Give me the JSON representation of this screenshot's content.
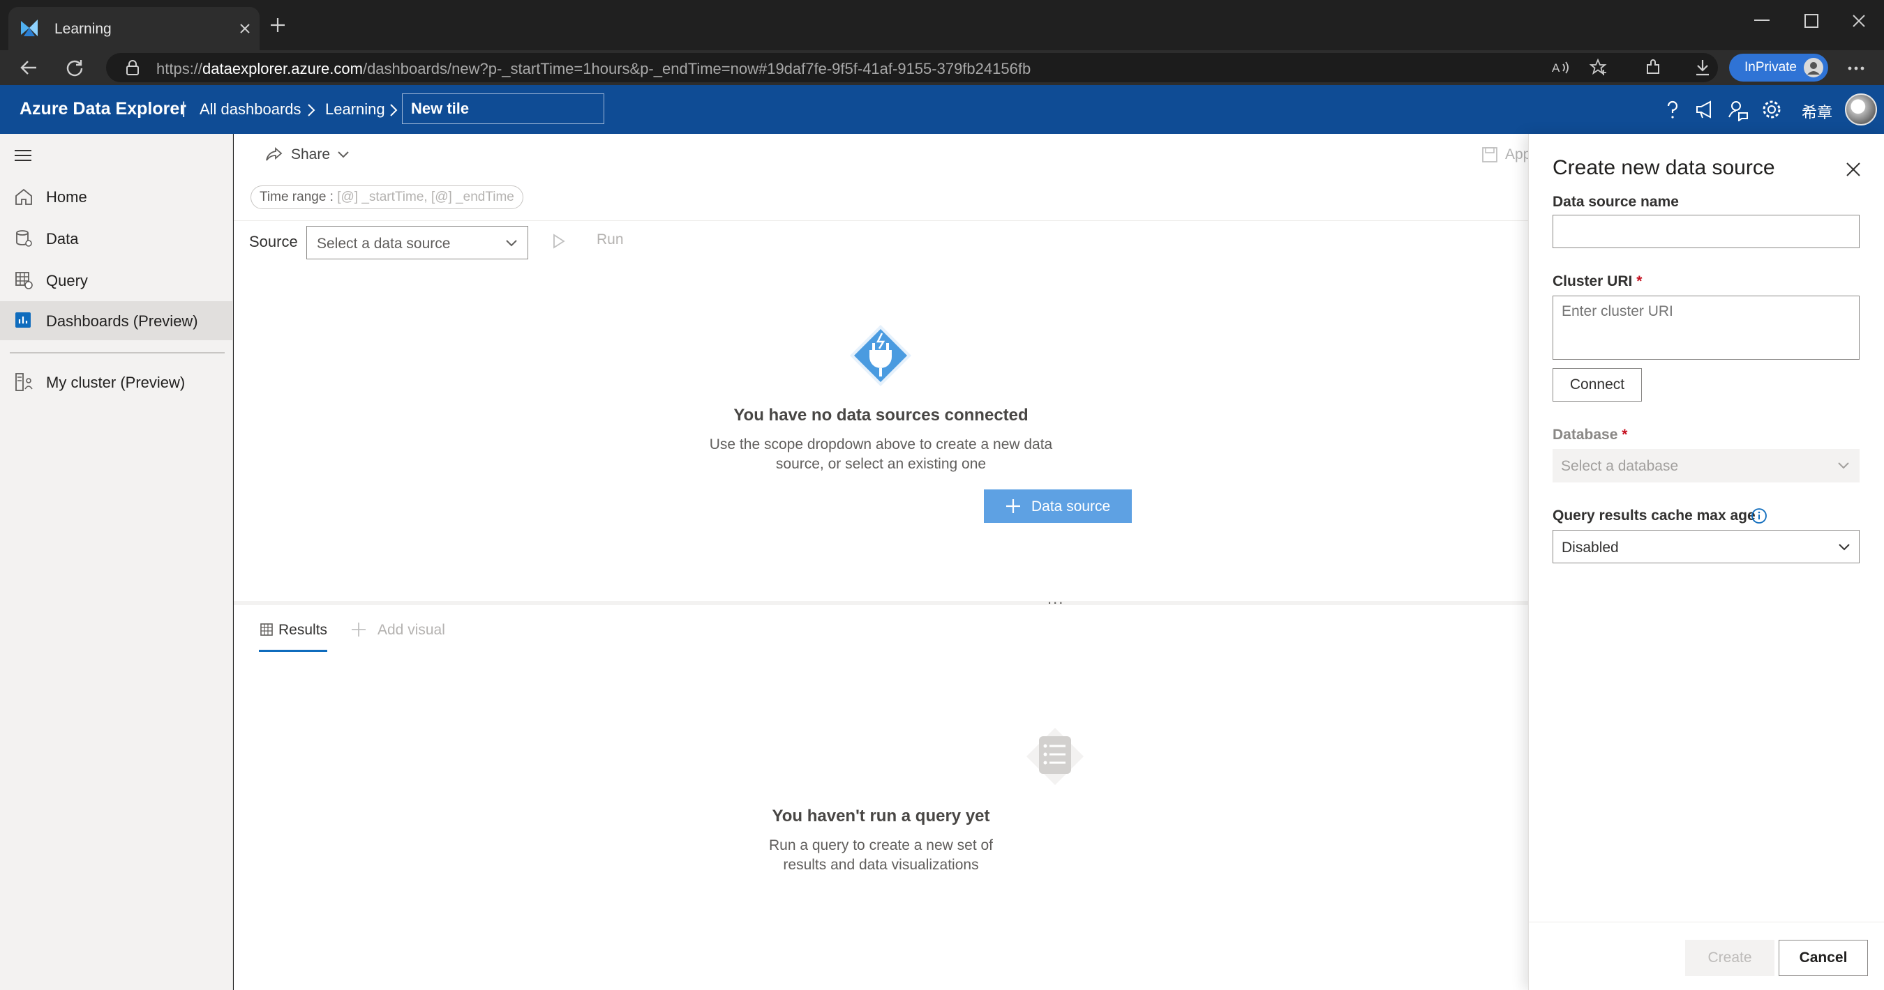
{
  "browser": {
    "tab_title": "Learning",
    "url_prefix": "https://",
    "url_host": "dataexplorer.azure.com",
    "url_rest": "/dashboards/new?p-_startTime=1hours&p-_endTime=now#19daf7fe-9f5f-41af-9155-379fb24156fb",
    "inprivate_label": "InPrivate"
  },
  "header": {
    "brand": "Azure Data Explorer",
    "separator": "|",
    "breadcrumb_all": "All dashboards",
    "breadcrumb_dashboard": "Learning",
    "tile_name": "New tile",
    "user_text": "希章"
  },
  "nav": {
    "items": [
      {
        "label": "Home",
        "icon": "home-icon"
      },
      {
        "label": "Data",
        "icon": "database-icon"
      },
      {
        "label": "Query",
        "icon": "query-icon"
      },
      {
        "label": "Dashboards (Preview)",
        "icon": "dashboard-icon"
      },
      {
        "label": "My cluster (Preview)",
        "icon": "cluster-icon"
      }
    ]
  },
  "main": {
    "share_label": "Share",
    "apply_partial": "App",
    "time_range_label": "Time range : ",
    "time_range_value": "[@] _startTime, [@] _endTime",
    "source_label": "Source",
    "source_placeholder": "Select a data source",
    "run_label": "Run",
    "empty_sources_title": "You have no data sources connected",
    "empty_sources_line1": "Use the scope dropdown above to create a new data",
    "empty_sources_line2": "source, or select an existing one",
    "data_source_button": "Data source",
    "splitter_dots": "...",
    "results_tab": "Results",
    "add_visual": "Add visual",
    "empty_query_title": "You haven't run a query yet",
    "empty_query_line1": "Run a query to create a new set of",
    "empty_query_line2": "results and data visualizations"
  },
  "panel": {
    "title": "Create new data source",
    "name_label": "Data source name",
    "name_value": "",
    "cluster_label": "Cluster URI",
    "required_mark": "*",
    "cluster_placeholder": "Enter cluster URI",
    "connect_label": "Connect",
    "database_label": "Database",
    "database_placeholder": "Select a database",
    "cache_label": "Query results cache max age",
    "cache_value": "Disabled",
    "create_label": "Create",
    "cancel_label": "Cancel"
  },
  "colors": {
    "header_blue": "#0f4c95",
    "accent": "#0f6cbd",
    "primary_button": "#5ea1e3",
    "required": "#c50f1f"
  }
}
